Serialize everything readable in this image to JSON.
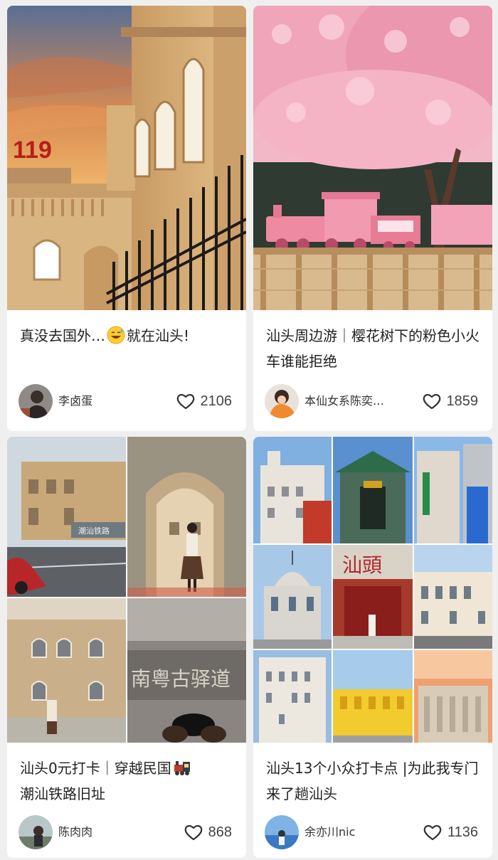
{
  "feed": {
    "cards": [
      {
        "title": "真没去国外…",
        "title_tail": "就在汕头!",
        "title_emoji": "sweat-smile-emoji",
        "cover_text": "119",
        "author": "李卤蛋",
        "likes": "2106"
      },
      {
        "title": "汕头周边游｜樱花树下的粉色小火车谁能拒绝",
        "author": "本仙女系陈奕…",
        "likes": "1859"
      },
      {
        "title": "汕头0元打卡｜穿越民国",
        "title_tail": "潮汕铁路旧址",
        "title_emoji": "train-emoji",
        "cover_text_1": "潮汕铁路",
        "cover_text_2": "南粤古驿道",
        "author": "陈肉肉",
        "likes": "868"
      },
      {
        "title": "汕头13个小众打卡点 |为此我专门来了趟汕头",
        "cover_text": "汕頭",
        "author": "余亦川nic",
        "likes": "1136"
      }
    ],
    "icons": {
      "like": "heart-outline-icon"
    },
    "colors": {
      "background": "#efefef",
      "card": "#ffffff",
      "title": "#222222",
      "meta": "#333333"
    }
  }
}
